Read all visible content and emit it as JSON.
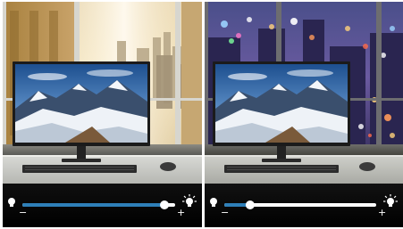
{
  "panels": [
    {
      "scene": "daytime-window-city",
      "monitor_screen": "snowy-mountain-landscape",
      "brightness_slider": {
        "level": 0.93,
        "minus_label": "−",
        "plus_label": "+",
        "track_color": "#2e7fb8",
        "knob_color": "#ffffff",
        "left_icon": "bulb-dim-icon",
        "right_icon": "bulb-bright-icon"
      }
    },
    {
      "scene": "night-window-city-lights",
      "monitor_screen": "snowy-mountain-landscape",
      "brightness_slider": {
        "level": 0.17,
        "minus_label": "−",
        "plus_label": "+",
        "track_color": "#2e7fb8",
        "knob_color": "#ffffff",
        "left_icon": "bulb-dim-icon",
        "right_icon": "bulb-bright-icon"
      }
    }
  ]
}
